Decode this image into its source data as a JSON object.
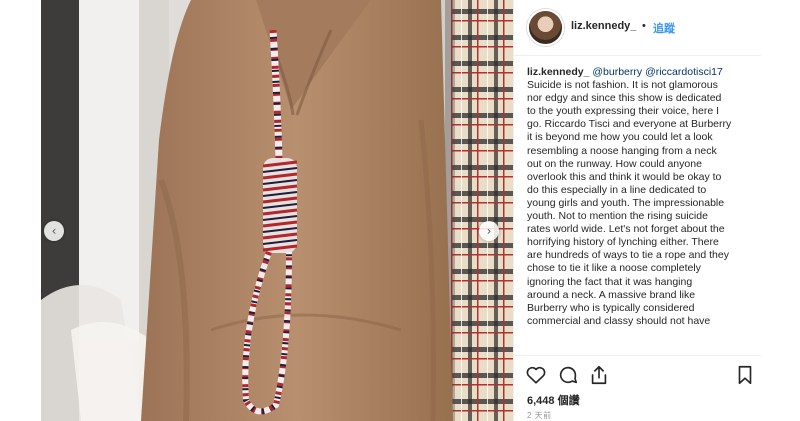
{
  "post": {
    "username": "liz.kennedy_",
    "separator": "•",
    "follow_label": "追蹤",
    "caption": {
      "author": "liz.kennedy_",
      "mention1": "@burberry",
      "mention2": "@riccardotisci17",
      "text": "Suicide is not fashion. It is not glamorous\nnor edgy and since this show is dedicated\nto the youth expressing their voice, here I\ngo. Riccardo Tisci and everyone at Burberry\nit is beyond me how you could let a look\nresembling a noose hanging from a neck\nout on the runway. How could anyone\noverlook this and think it would be okay to\ndo this especially in a line dedicated to\nyoung girls and youth. The impressionable\nyouth. Not to mention the rising suicide\nrates world wide. Let's not forget about the\nhorrifying history of lynching either. There\nare hundreds of ways to tie a rope and they\nchose to tie it like a noose completely\nignoring the fact that it was hanging\naround a neck. A massive brand like\nBurberry who is typically considered\ncommercial and classy should not have"
    },
    "likes": "6,448 個讚",
    "time_ago": "2 天前"
  },
  "icons": {
    "prev": "chevron-left-icon",
    "next": "chevron-right-icon",
    "like": "heart-icon",
    "comment": "comment-icon",
    "share": "share-icon",
    "save": "bookmark-icon"
  },
  "colors": {
    "link": "#3897f0",
    "hoodie": "#b48a6a",
    "text": "#262626"
  }
}
